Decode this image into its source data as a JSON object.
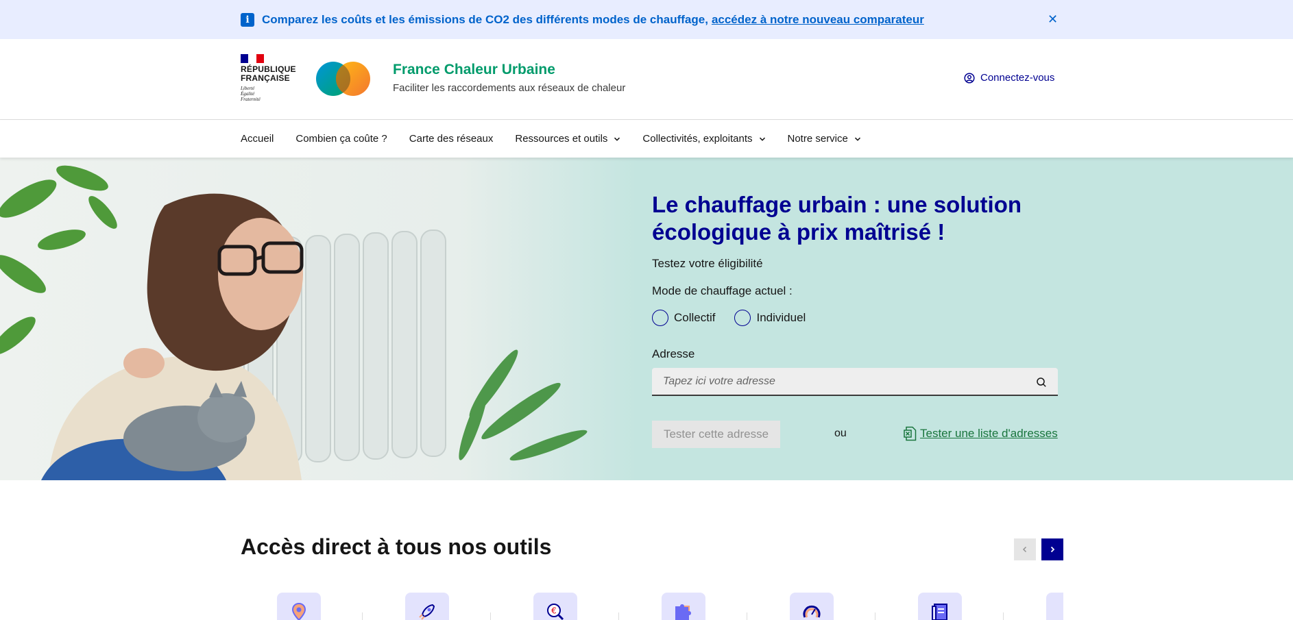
{
  "notice": {
    "text": "Comparez les coûts et les émissions de CO2 des différents modes de chauffage,",
    "link": "accédez à notre nouveau comparateur",
    "icon": "info-icon",
    "close_icon": "close-icon"
  },
  "header": {
    "republic": {
      "line1": "RÉPUBLIQUE",
      "line2": "FRANÇAISE",
      "motto": [
        "Liberté",
        "Égalité",
        "Fraternité"
      ]
    },
    "service_title": "France Chaleur Urbaine",
    "service_tagline": "Faciliter les raccordements aux réseaux de chaleur",
    "connect_label": "Connectez-vous",
    "connect_icon": "user-circle-icon"
  },
  "nav": {
    "items": [
      {
        "label": "Accueil",
        "dropdown": false
      },
      {
        "label": "Combien ça coûte ?",
        "dropdown": false
      },
      {
        "label": "Carte des réseaux",
        "dropdown": false
      },
      {
        "label": "Ressources et outils",
        "dropdown": true
      },
      {
        "label": "Collectivités, exploitants",
        "dropdown": true
      },
      {
        "label": "Notre service",
        "dropdown": true
      }
    ]
  },
  "hero": {
    "title": "Le chauffage urbain : une solution écologique à prix maîtrisé !",
    "subtitle": "Testez votre éligibilité",
    "mode_label": "Mode de chauffage actuel :",
    "radios": [
      "Collectif",
      "Individuel"
    ],
    "address_label": "Adresse",
    "address_placeholder": "Tapez ici votre adresse",
    "address_value": "",
    "test_button": "Tester cette adresse",
    "or": "ou",
    "list_link": "Tester une liste d'adresses"
  },
  "tools": {
    "title": "Accès direct à tous nos outils",
    "icons": [
      "map-pin-icon",
      "rocket-icon",
      "euro-magnifier-icon",
      "puzzle-icon",
      "gauge-icon",
      "document-icon",
      "chevron-left-icon"
    ]
  },
  "colors": {
    "accent": "#000091",
    "brand_green": "#009b6b",
    "notice_blue": "#0063cb",
    "hero_bg": "#c4e5e0",
    "notice_bg": "#e8edff",
    "link_green": "#18753c"
  }
}
